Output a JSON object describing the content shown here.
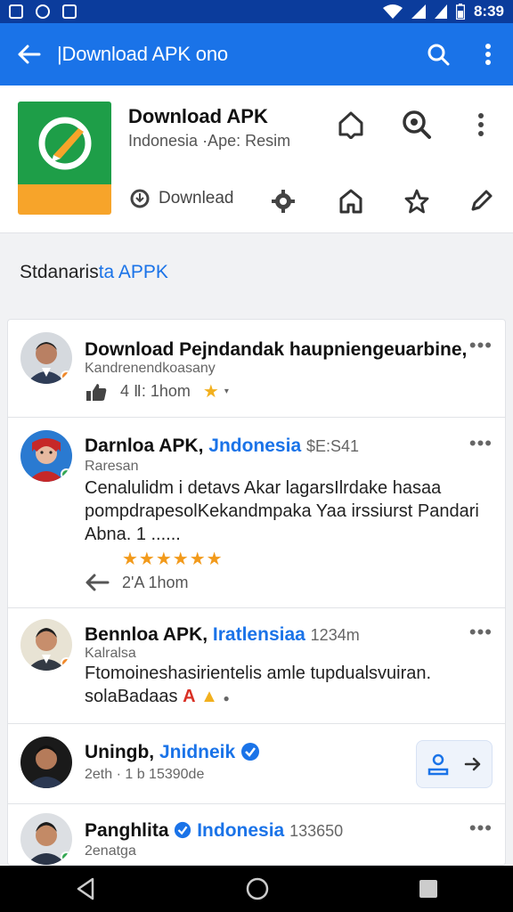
{
  "status": {
    "time": "8:39"
  },
  "appbar": {
    "title": "|Download APK ono"
  },
  "header": {
    "app_name": "Download APK",
    "app_subtitle": "Indonesia ·Ape: Resim",
    "download_label": "Downlead"
  },
  "section": {
    "title_main": "Stdanaris",
    "title_accent": "ta APPK"
  },
  "posts": [
    {
      "name": "Download Pejndandak haupniengeuarbine,",
      "sub": "Kandrenendkoasany",
      "action": "4 Ⅱ: 1hom",
      "badge_color": "#f0892b"
    },
    {
      "name": "Darnloa APK,",
      "accent": "Jndonesia",
      "meta": "$E:S41",
      "sub": "Raresan",
      "body": "Cenalulidm i detavs Akar lagarsIlrdake hasaa pompdrapesolKekandmpaka Yaa irssiurst Pandari Abna.  1  ......",
      "stars": "★★★★★★",
      "action": "2'A  1hom",
      "badge_color": "#34a853"
    },
    {
      "name": "Bennloa APK,",
      "accent": "Iratlensiaa",
      "meta": "1234m",
      "sub": "Kalralsa",
      "body": "Ftomoineshasirientelis amle tupdualsvuiran. solaBadaas",
      "emoji_a": "A",
      "badge_color": "#f0892b"
    },
    {
      "name": "Uningb,",
      "accent": "Jnidneik",
      "sub": "2eth · 1 b 15390de"
    },
    {
      "name": "Panghlita",
      "accent": "Indonesia",
      "meta": "133650",
      "sub": "2enatga",
      "badge_color": "#34a853"
    }
  ],
  "colors": {
    "primary": "#1a73e8",
    "statusbar": "#0b3c9c",
    "app_icon_green": "#1e9e48",
    "app_icon_orange": "#f7a42a"
  }
}
